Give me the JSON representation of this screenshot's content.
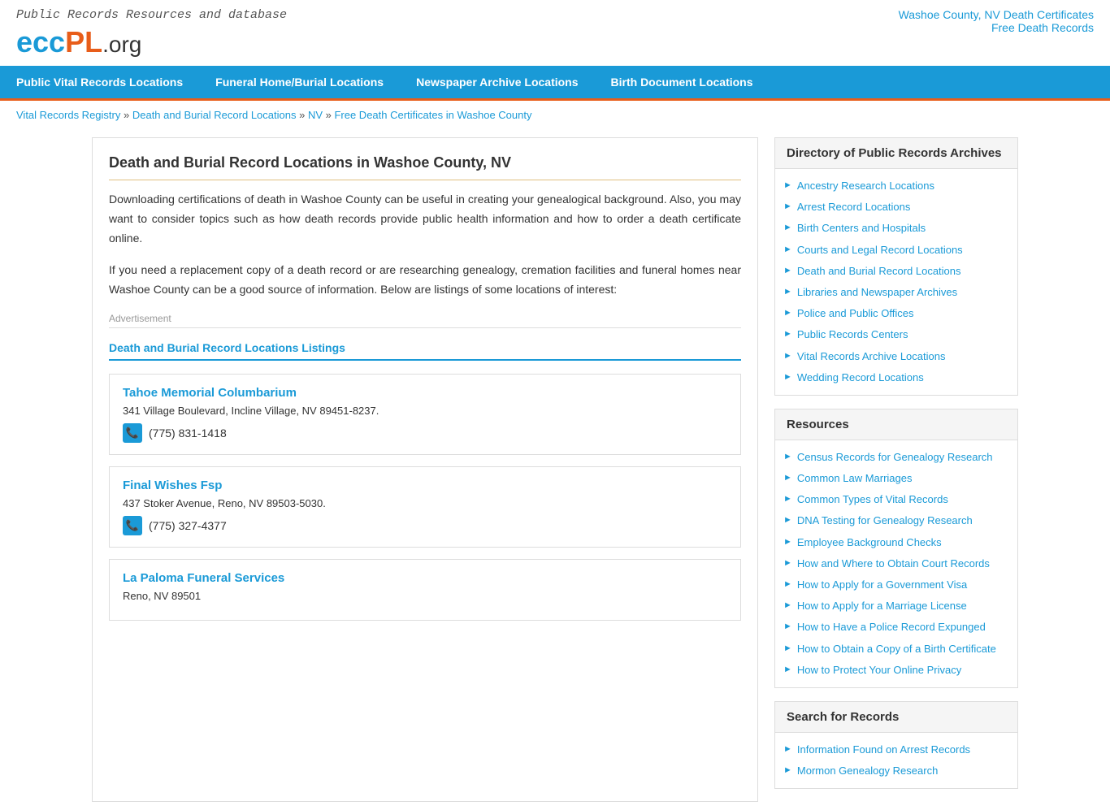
{
  "topRight": {
    "link1": "Washoe County, NV Death Certificates",
    "link2": "Free Death Records"
  },
  "logo": {
    "tagline": "Public Records Resources and database",
    "ecc": "ecc",
    "pl": "PL",
    "org": ".org"
  },
  "nav": {
    "items": [
      "Public Vital Records Locations",
      "Funeral Home/Burial Locations",
      "Newspaper Archive Locations",
      "Birth Document Locations"
    ]
  },
  "breadcrumb": {
    "items": [
      "Vital Records Registry",
      "Death and Burial Record Locations",
      "NV",
      "Free Death Certificates in Washoe County"
    ]
  },
  "main": {
    "title": "Death and Burial Record Locations in Washoe County, NV",
    "para1": "Downloading certifications of death in Washoe County can be useful in creating your genealogical background. Also, you may want to consider topics such as how death records provide public health information and how to order a death certificate online.",
    "para2": "If you need a replacement copy of a death record or are researching genealogy, cremation facilities and funeral homes near Washoe County can be a good source of information. Below are listings of some locations of interest:",
    "adLabel": "Advertisement",
    "listingsHeader": "Death and Burial Record Locations Listings",
    "listings": [
      {
        "name": "Tahoe Memorial Columbarium",
        "address": "341 Village Boulevard, Incline Village, NV 89451-8237.",
        "phone": "(775)  831-1418"
      },
      {
        "name": "Final Wishes Fsp",
        "address": "437 Stoker Avenue, Reno, NV 89503-5030.",
        "phone": "(775)  327-4377"
      },
      {
        "name": "La Paloma Funeral Services",
        "address": "Reno, NV 89501",
        "phone": ""
      }
    ]
  },
  "sidebar": {
    "directory": {
      "title": "Directory of Public Records Archives",
      "links": [
        "Ancestry Research Locations",
        "Arrest Record Locations",
        "Birth Centers and Hospitals",
        "Courts and Legal Record Locations",
        "Death and Burial Record Locations",
        "Libraries and Newspaper Archives",
        "Police and Public Offices",
        "Public Records Centers",
        "Vital Records Archive Locations",
        "Wedding Record Locations"
      ]
    },
    "resources": {
      "title": "Resources",
      "links": [
        "Census Records for Genealogy Research",
        "Common Law Marriages",
        "Common Types of Vital Records",
        "DNA Testing for Genealogy Research",
        "Employee Background Checks",
        "How and Where to Obtain Court Records",
        "How to Apply for a Government Visa",
        "How to Apply for a Marriage License",
        "How to Have a Police Record Expunged",
        "How to Obtain a Copy of a Birth Certificate",
        "How to Protect Your Online Privacy"
      ]
    },
    "search": {
      "title": "Search for Records",
      "links": [
        "Information Found on Arrest Records",
        "Mormon Genealogy Research"
      ]
    }
  }
}
